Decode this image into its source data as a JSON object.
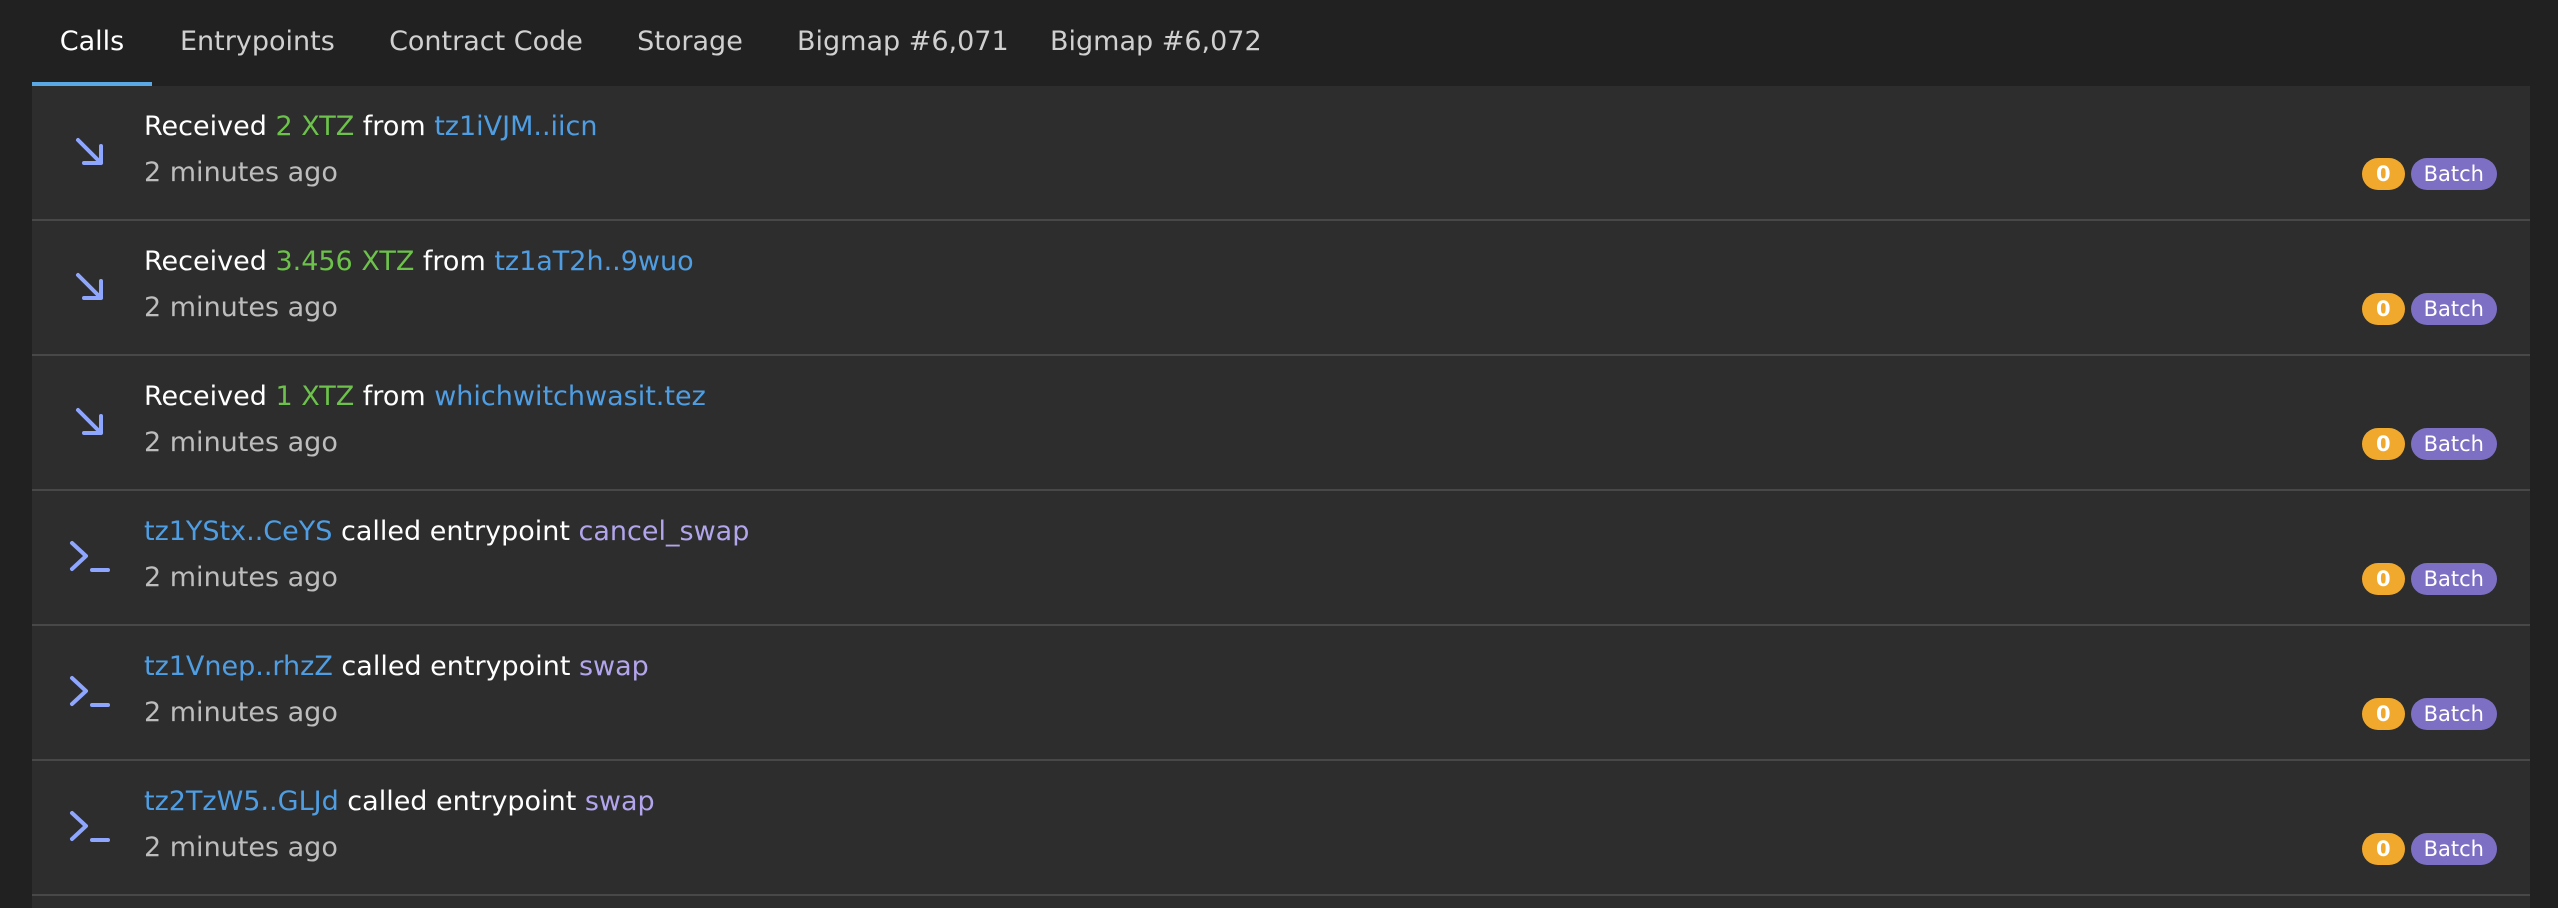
{
  "tabs": [
    {
      "label": "Calls"
    },
    {
      "label": "Entrypoints"
    },
    {
      "label": "Contract Code"
    },
    {
      "label": "Storage"
    },
    {
      "label": "Bigmap #6,071"
    },
    {
      "label": "Bigmap #6,072"
    }
  ],
  "rows": [
    {
      "kind": "received",
      "prefix": "Received ",
      "amount": "2 XTZ",
      "mid": " from ",
      "addr": "tz1iVJM..iicn",
      "time": "2 minutes ago",
      "count": "0",
      "badge": "Batch",
      "icon": "arrow-down-right-icon"
    },
    {
      "kind": "received",
      "prefix": "Received ",
      "amount": "3.456 XTZ",
      "mid": " from ",
      "addr": "tz1aT2h..9wuo",
      "time": "2 minutes ago",
      "count": "0",
      "badge": "Batch",
      "icon": "arrow-down-right-icon"
    },
    {
      "kind": "received",
      "prefix": "Received ",
      "amount": "1 XTZ",
      "mid": " from ",
      "addr": "whichwitchwasit.tez",
      "time": "2 minutes ago",
      "count": "0",
      "badge": "Batch",
      "icon": "arrow-down-right-icon"
    },
    {
      "kind": "call",
      "addr": "tz1YStx..CeYS",
      "mid": " called entrypoint ",
      "entrypoint": "cancel_swap",
      "time": "2 minutes ago",
      "count": "0",
      "badge": "Batch",
      "icon": "terminal-prompt-icon"
    },
    {
      "kind": "call",
      "addr": "tz1Vnep..rhzZ",
      "mid": " called entrypoint ",
      "entrypoint": "swap",
      "time": "2 minutes ago",
      "count": "0",
      "badge": "Batch",
      "icon": "terminal-prompt-icon"
    },
    {
      "kind": "call",
      "addr": "tz2TzW5..GLJd",
      "mid": " called entrypoint ",
      "entrypoint": "swap",
      "time": "2 minutes ago",
      "count": "0",
      "badge": "Batch",
      "icon": "terminal-prompt-icon"
    }
  ],
  "colors": {
    "background": "#212121",
    "panel": "#2d2d2d",
    "active_tab_underline": "#5aa9e6",
    "amount": "#6cc24a",
    "address": "#4f9ee3",
    "entrypoint": "#b3a5ec",
    "count_badge": "#f0a92c",
    "batch_badge": "#7c6fc4",
    "icon": "#8fa6ff"
  }
}
